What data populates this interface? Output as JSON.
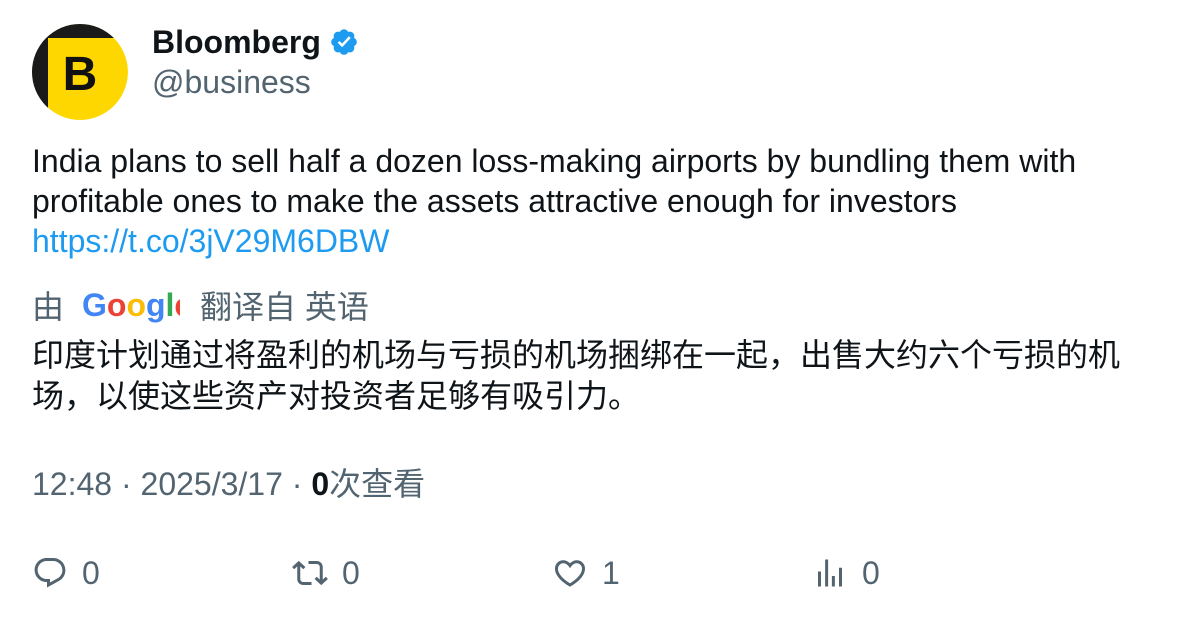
{
  "author": {
    "display_name": "Bloomberg",
    "handle": "@business",
    "avatar_letter": "B",
    "verified": true
  },
  "tweet": {
    "text": "India plans to sell half a dozen loss-making airports by bundling them with profitable ones to make the assets attractive enough for investors",
    "link": "https://t.co/3jV29M6DBW"
  },
  "translation": {
    "prefix": "由",
    "provider": "Google",
    "suffix": "翻译自 英语",
    "text": "印度计划通过将盈利的机场与亏损的机场捆绑在一起，出售大约六个亏损的机场，以使这些资产对投资者足够有吸引力。"
  },
  "meta": {
    "time": "12:48",
    "separator": "·",
    "date": "2025/3/17",
    "views_count": "0",
    "views_label": "次查看"
  },
  "actions": {
    "reply": "0",
    "retweet": "0",
    "like": "1",
    "views": "0"
  },
  "colors": {
    "link": "#1d9bf0",
    "verified": "#1d9bf0",
    "secondary_text": "#536471",
    "avatar_yellow": "#ffd700"
  },
  "icons": [
    "verified-badge-icon",
    "reply-icon",
    "retweet-icon",
    "like-icon",
    "views-icon"
  ]
}
